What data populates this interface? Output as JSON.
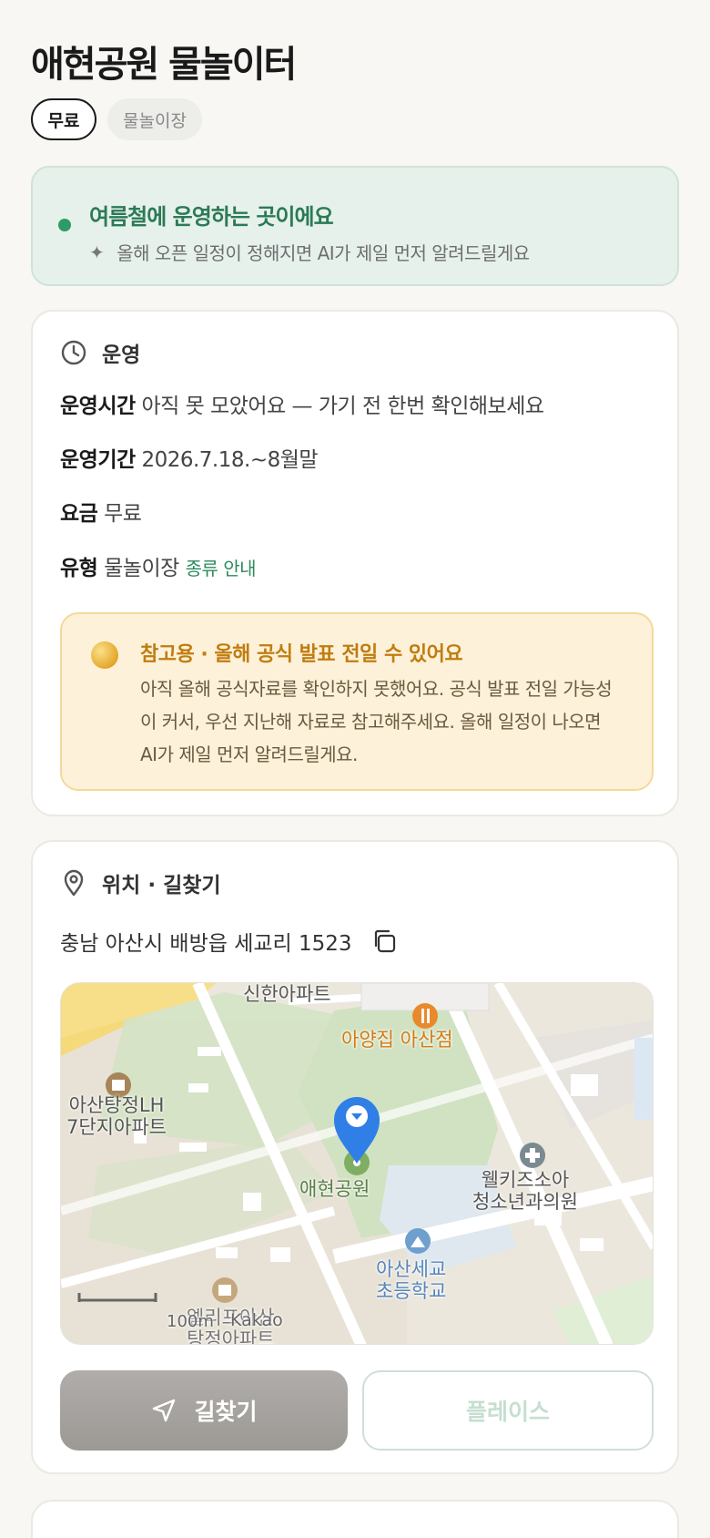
{
  "header": {
    "title": "애현공원 물놀이터"
  },
  "chips": [
    {
      "label": "무료",
      "active": true
    },
    {
      "label": "물놀이장",
      "active": false
    }
  ],
  "season_banner": {
    "title": "여름철에 운영하는 곳이에요",
    "subtitle": "올해 오픈 일정이 정해지면 AI가 제일 먼저 알려드릴게요",
    "accent": "#2e9a66"
  },
  "operation": {
    "section_title": "운영",
    "hours_label": "운영시간",
    "hours_value": "아직 못 모았어요 — 가기 전 한번 확인해보세요",
    "period_label": "운영기간",
    "period_value": "2026.7.18.~8월말",
    "fee_label": "요금",
    "fee_value": "무료",
    "type_label": "유형",
    "type_value": "물놀이장",
    "type_link": "종류 안내",
    "notice": {
      "title": "참고용 · 올해 공식 발표 전일 수 있어요",
      "body": "아직 올해 공식자료를 확인하지 못했어요. 공식 발표 전일 가능성이 커서, 우선 지난해 자료로 참고해주세요. 올해 일정이 나오면 AI가 제일 먼저 알려드릴게요."
    }
  },
  "location": {
    "section_title": "위치 · 길찾기",
    "address": "충남 아산시 배방읍 세교리 1523",
    "map": {
      "labels": {
        "apt_top": "신한아파트",
        "restaurant": "아양집 아산점",
        "apt_left_1": "아산탕정LH",
        "apt_left_2": "7단지아파트",
        "park": "애현공원",
        "clinic_1": "웰키즈소아",
        "clinic_2": "청소년과의원",
        "school_1": "아산세교",
        "school_2": "초등학교",
        "apt_bottom_1": "엘리프아산",
        "apt_bottom_2": "탕정아파트",
        "scale": "100m",
        "attribution": "Kakao"
      }
    },
    "directions_button": "길찾기",
    "place_button": "플레이스"
  }
}
